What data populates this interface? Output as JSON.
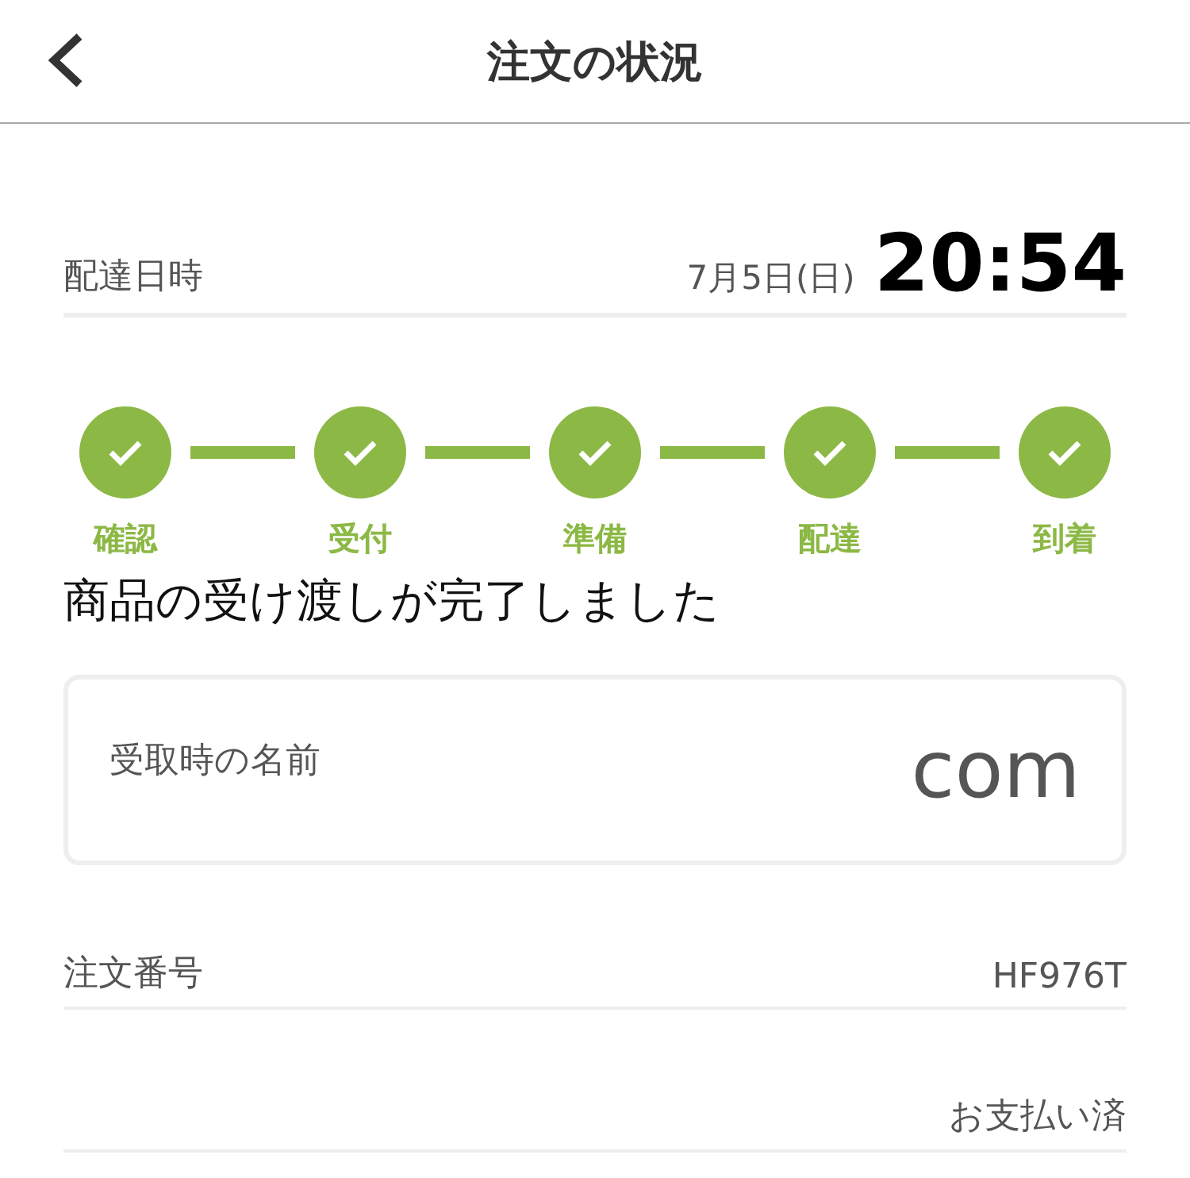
{
  "header": {
    "title": "注文の状況"
  },
  "delivery": {
    "label": "配達日時",
    "date": "7月5日(日)",
    "time": "20:54"
  },
  "steps": [
    {
      "label": "確認",
      "done": true
    },
    {
      "label": "受付",
      "done": true
    },
    {
      "label": "準備",
      "done": true
    },
    {
      "label": "配達",
      "done": true
    },
    {
      "label": "到着",
      "done": true
    }
  ],
  "message": "商品の受け渡しが完了しました",
  "receiver": {
    "label": "受取時の名前",
    "value": "com"
  },
  "order": {
    "label": "注文番号",
    "value": "HF976T"
  },
  "payment": {
    "status": "お支払い済"
  }
}
